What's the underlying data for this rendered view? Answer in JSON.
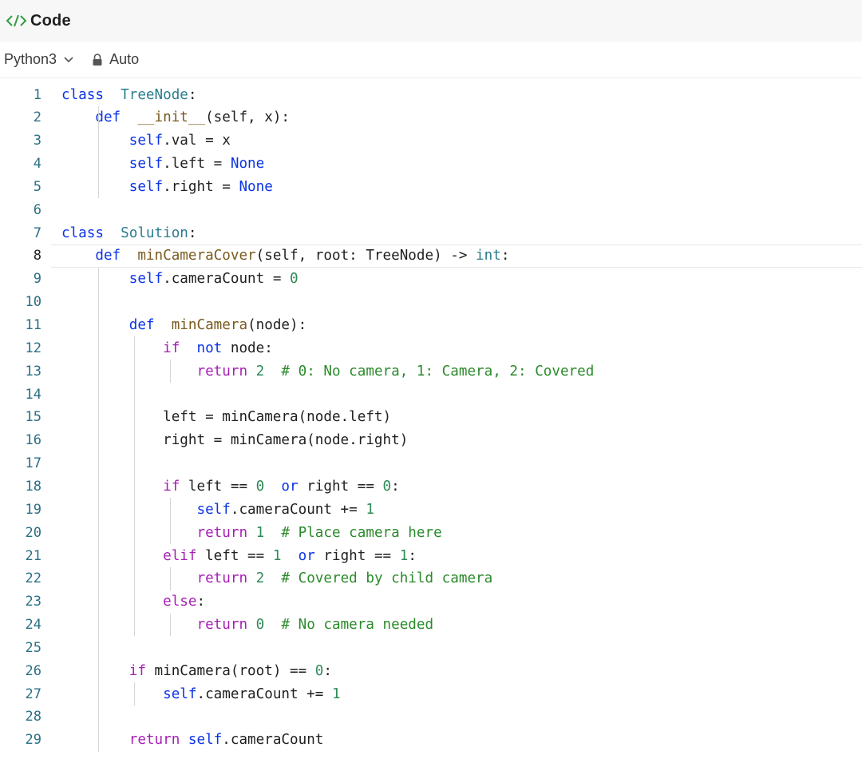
{
  "header": {
    "title": "Code",
    "icon": "code-icon"
  },
  "toolbar": {
    "language": "Python3",
    "mode": "Auto"
  },
  "colors": {
    "keyword": "#0b33e6",
    "control_keyword": "#a61fb5",
    "class_name": "#2a7d8e",
    "function_name": "#7a5a1e",
    "number": "#2e8b57",
    "comment": "#2b8a2b",
    "line_number": "#2a6f85"
  },
  "editor": {
    "active_line": 8,
    "lines": [
      {
        "n": "1",
        "tokens": [
          [
            "kw",
            "class"
          ],
          [
            "",
            "  "
          ],
          [
            "cls",
            "TreeNode"
          ],
          [
            "",
            ":"
          ]
        ]
      },
      {
        "n": "2",
        "tokens": [
          [
            "",
            "    "
          ],
          [
            "kw",
            "def"
          ],
          [
            "",
            "  "
          ],
          [
            "fn",
            "__init__"
          ],
          [
            "",
            "(self, x):"
          ]
        ]
      },
      {
        "n": "3",
        "tokens": [
          [
            "",
            "        "
          ],
          [
            "self",
            "self"
          ],
          [
            "",
            ".val = x"
          ]
        ]
      },
      {
        "n": "4",
        "tokens": [
          [
            "",
            "        "
          ],
          [
            "self",
            "self"
          ],
          [
            "",
            ".left = "
          ],
          [
            "none",
            "None"
          ]
        ]
      },
      {
        "n": "5",
        "tokens": [
          [
            "",
            "        "
          ],
          [
            "self",
            "self"
          ],
          [
            "",
            ".right = "
          ],
          [
            "none",
            "None"
          ]
        ]
      },
      {
        "n": "6",
        "tokens": []
      },
      {
        "n": "7",
        "tokens": [
          [
            "kw",
            "class"
          ],
          [
            "",
            "  "
          ],
          [
            "cls",
            "Solution"
          ],
          [
            "",
            ":"
          ]
        ]
      },
      {
        "n": "8",
        "tokens": [
          [
            "",
            "    "
          ],
          [
            "kw",
            "def"
          ],
          [
            "",
            "  "
          ],
          [
            "fn",
            "minCameraCover"
          ],
          [
            "",
            "(self, root: TreeNode) -> "
          ],
          [
            "ty",
            "int"
          ],
          [
            "",
            ":"
          ]
        ]
      },
      {
        "n": "9",
        "tokens": [
          [
            "",
            "        "
          ],
          [
            "self",
            "self"
          ],
          [
            "",
            ".cameraCount = "
          ],
          [
            "num",
            "0"
          ]
        ]
      },
      {
        "n": "10",
        "tokens": []
      },
      {
        "n": "11",
        "tokens": [
          [
            "",
            "        "
          ],
          [
            "kw",
            "def"
          ],
          [
            "",
            "  "
          ],
          [
            "fn",
            "minCamera"
          ],
          [
            "",
            "(node):"
          ]
        ]
      },
      {
        "n": "12",
        "tokens": [
          [
            "",
            "            "
          ],
          [
            "kw2",
            "if"
          ],
          [
            "",
            "  "
          ],
          [
            "kw",
            "not"
          ],
          [
            "",
            " node:"
          ]
        ]
      },
      {
        "n": "13",
        "tokens": [
          [
            "",
            "                "
          ],
          [
            "kw2",
            "return"
          ],
          [
            "",
            " "
          ],
          [
            "num",
            "2"
          ],
          [
            "",
            "  "
          ],
          [
            "cm",
            "# 0: No camera, 1: Camera, 2: Covered"
          ]
        ]
      },
      {
        "n": "14",
        "tokens": []
      },
      {
        "n": "15",
        "tokens": [
          [
            "",
            "            left = minCamera(node.left)"
          ]
        ]
      },
      {
        "n": "16",
        "tokens": [
          [
            "",
            "            right = minCamera(node.right)"
          ]
        ]
      },
      {
        "n": "17",
        "tokens": []
      },
      {
        "n": "18",
        "tokens": [
          [
            "",
            "            "
          ],
          [
            "kw2",
            "if"
          ],
          [
            "",
            " left == "
          ],
          [
            "num",
            "0"
          ],
          [
            "",
            "  "
          ],
          [
            "kw",
            "or"
          ],
          [
            "",
            " right == "
          ],
          [
            "num",
            "0"
          ],
          [
            "",
            ":"
          ]
        ]
      },
      {
        "n": "19",
        "tokens": [
          [
            "",
            "                "
          ],
          [
            "self",
            "self"
          ],
          [
            "",
            ".cameraCount += "
          ],
          [
            "num",
            "1"
          ]
        ]
      },
      {
        "n": "20",
        "tokens": [
          [
            "",
            "                "
          ],
          [
            "kw2",
            "return"
          ],
          [
            "",
            " "
          ],
          [
            "num",
            "1"
          ],
          [
            "",
            "  "
          ],
          [
            "cm",
            "# Place camera here"
          ]
        ]
      },
      {
        "n": "21",
        "tokens": [
          [
            "",
            "            "
          ],
          [
            "kw2",
            "elif"
          ],
          [
            "",
            " left == "
          ],
          [
            "num",
            "1"
          ],
          [
            "",
            "  "
          ],
          [
            "kw",
            "or"
          ],
          [
            "",
            " right == "
          ],
          [
            "num",
            "1"
          ],
          [
            "",
            ":"
          ]
        ]
      },
      {
        "n": "22",
        "tokens": [
          [
            "",
            "                "
          ],
          [
            "kw2",
            "return"
          ],
          [
            "",
            " "
          ],
          [
            "num",
            "2"
          ],
          [
            "",
            "  "
          ],
          [
            "cm",
            "# Covered by child camera"
          ]
        ]
      },
      {
        "n": "23",
        "tokens": [
          [
            "",
            "            "
          ],
          [
            "kw2",
            "else"
          ],
          [
            "",
            ":"
          ]
        ]
      },
      {
        "n": "24",
        "tokens": [
          [
            "",
            "                "
          ],
          [
            "kw2",
            "return"
          ],
          [
            "",
            " "
          ],
          [
            "num",
            "0"
          ],
          [
            "",
            "  "
          ],
          [
            "cm",
            "# No camera needed"
          ]
        ]
      },
      {
        "n": "25",
        "tokens": []
      },
      {
        "n": "26",
        "tokens": [
          [
            "",
            "        "
          ],
          [
            "kw2",
            "if"
          ],
          [
            "",
            " minCamera(root) == "
          ],
          [
            "num",
            "0"
          ],
          [
            "",
            ":"
          ]
        ]
      },
      {
        "n": "27",
        "tokens": [
          [
            "",
            "            "
          ],
          [
            "self",
            "self"
          ],
          [
            "",
            ".cameraCount += "
          ],
          [
            "num",
            "1"
          ]
        ]
      },
      {
        "n": "28",
        "tokens": []
      },
      {
        "n": "29",
        "tokens": [
          [
            "",
            "        "
          ],
          [
            "kw2",
            "return"
          ],
          [
            "",
            " "
          ],
          [
            "self",
            "self"
          ],
          [
            "",
            ".cameraCount"
          ]
        ]
      }
    ]
  }
}
